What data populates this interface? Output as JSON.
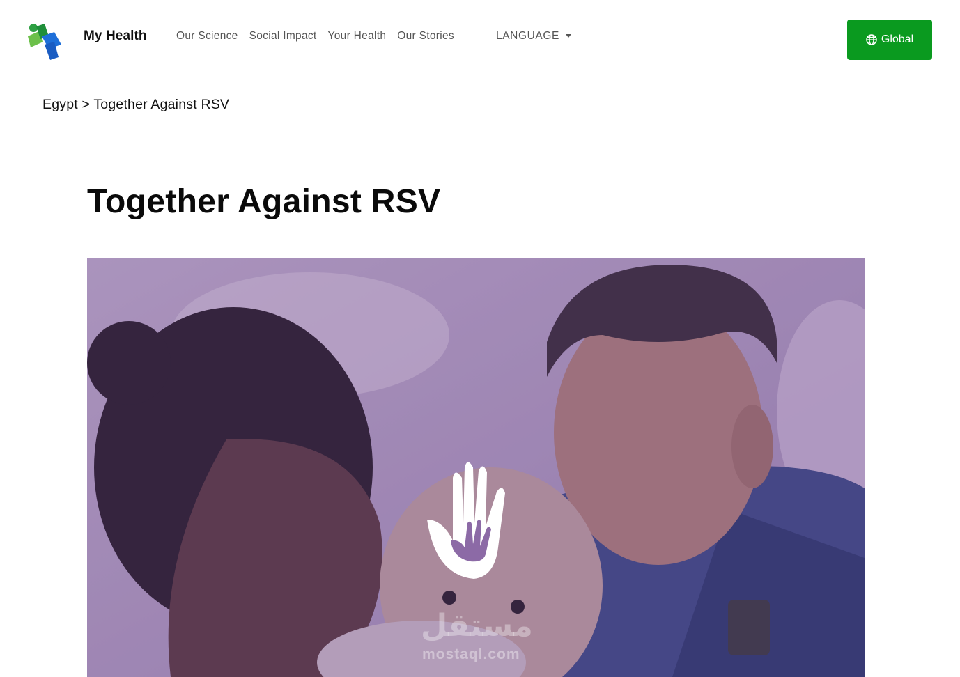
{
  "header": {
    "brand": "My Health",
    "nav": [
      "Our Science",
      "Social Impact",
      "Your Health",
      "Our Stories"
    ],
    "language_label": "LANGUAGE",
    "global_button": "Global"
  },
  "breadcrumb": {
    "parent": "Egypt",
    "separator": ">",
    "current": "Together Against RSV"
  },
  "page": {
    "title": "Together Against RSV"
  },
  "hero": {
    "watermark_arabic": "مستقل",
    "watermark_latin": "mostaql.com"
  },
  "colors": {
    "accent_green": "#0a9a1f",
    "hero_tint": "#7a5a9a"
  },
  "icons": [
    "logo-icon",
    "globe-icon",
    "caret-down-icon",
    "hand-in-hand-icon"
  ]
}
